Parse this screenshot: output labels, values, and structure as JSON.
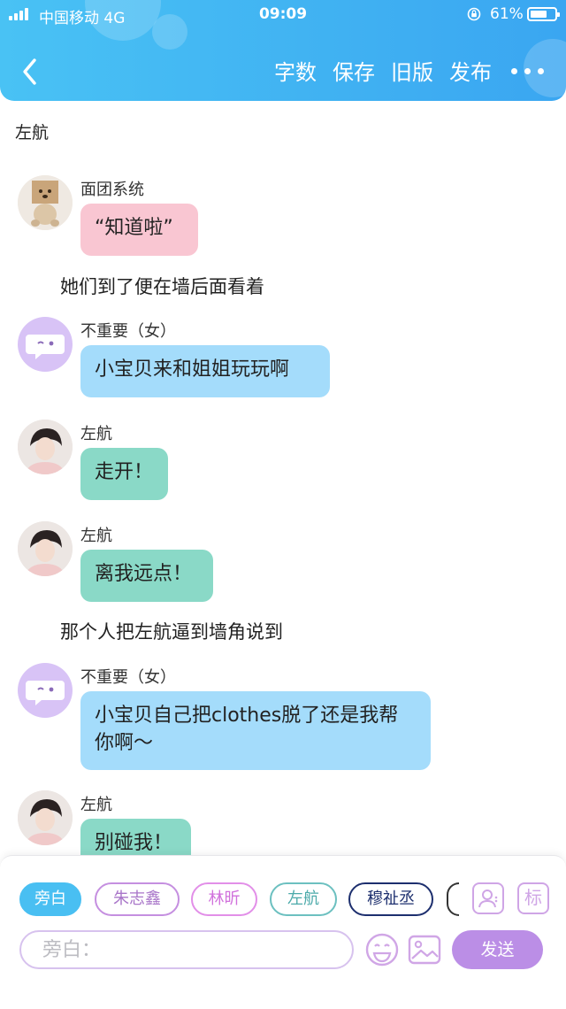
{
  "status_bar": {
    "carrier": "中国移动  4G",
    "time": "09:09",
    "battery": "61%"
  },
  "header": {
    "actions": [
      "字数",
      "保存",
      "旧版",
      "发布"
    ]
  },
  "chat": {
    "title": "左航",
    "items": [
      {
        "kind": "message",
        "sender": "面团系统",
        "text": "“知道啦”",
        "style": "pink",
        "avatar": "bear-avatar"
      },
      {
        "kind": "narration",
        "text": "她们到了便在墙后面看着"
      },
      {
        "kind": "message",
        "sender": "不重要（女）",
        "text": "小宝贝来和姐姐玩玩啊",
        "style": "blue",
        "avatar": "purple-chat-avatar"
      },
      {
        "kind": "message",
        "sender": "左航",
        "text": "走开！",
        "style": "teal",
        "avatar": "photo-avatar"
      },
      {
        "kind": "message",
        "sender": "左航",
        "text": "离我远点！",
        "style": "teal",
        "avatar": "photo-avatar"
      },
      {
        "kind": "narration",
        "text": "那个人把左航逼到墙角说到"
      },
      {
        "kind": "message",
        "sender": "不重要（女）",
        "text": "小宝贝自己把clothes脱了还是我帮你啊～",
        "style": "blue",
        "avatar": "purple-chat-avatar"
      },
      {
        "kind": "message",
        "sender": "左航",
        "text": "别碰我！",
        "style": "teal",
        "avatar": "photo-avatar"
      }
    ]
  },
  "bottom": {
    "roles": [
      "旁白",
      "朱志鑫",
      "林昕",
      "左航",
      "穆祉丞"
    ],
    "tag_label": "标",
    "input_placeholder": "旁白：",
    "send_label": "发送"
  },
  "colors": {
    "header": "#3aa6f1",
    "bubble_pink": "#f9c6d2",
    "bubble_blue": "#a4dcfb",
    "bubble_teal": "#8ad9c7",
    "send_button": "#bb8ee6",
    "chip_narrator": "#49bff2",
    "chip_zhu": "#c58fe0",
    "chip_lin": "#e28fe8",
    "chip_zuo": "#6cc0c0",
    "chip_mu": "#1d2f6e"
  }
}
